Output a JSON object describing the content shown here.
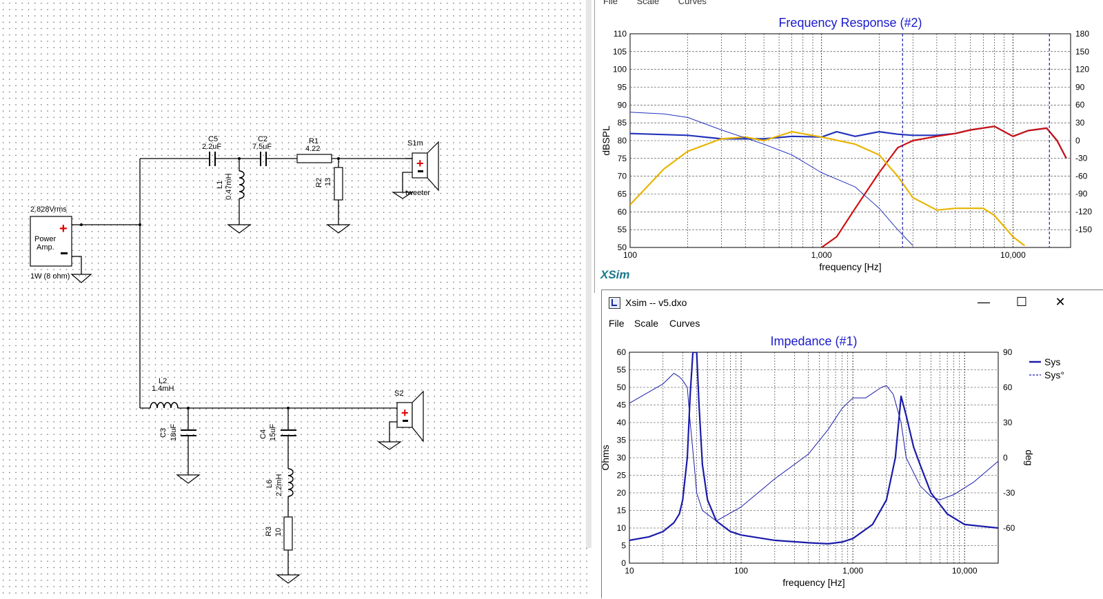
{
  "schematic": {
    "source_label": "2.828Vrms",
    "amp_label_line1": "Power",
    "amp_label_line2": "Amp.",
    "amp_power_label": "1W (8 ohm)",
    "components": {
      "C5": {
        "name": "C5",
        "value": "2.2uF"
      },
      "C2": {
        "name": "C2",
        "value": "7.5uF"
      },
      "R1": {
        "name": "R1",
        "value": "4.22"
      },
      "L1": {
        "name": "L1",
        "value": "0.47mH"
      },
      "R2": {
        "name": "R2",
        "value": "13"
      },
      "S1m": {
        "name": "S1m",
        "label": "tweeter"
      },
      "L2": {
        "name": "L2",
        "value": "1.4mH"
      },
      "C3": {
        "name": "C3",
        "value": "18uF"
      },
      "C4": {
        "name": "C4",
        "value": "15uF"
      },
      "L6": {
        "name": "L6",
        "value": "2.2mH"
      },
      "R3": {
        "name": "R3",
        "value": "10"
      },
      "S2": {
        "name": "S2"
      }
    }
  },
  "fr_window": {
    "menu": [
      "File",
      "Scale",
      "Curves"
    ],
    "logo": "XSim"
  },
  "imp_window": {
    "title": "Xsim -- v5.dxo",
    "menu": [
      "File",
      "Scale",
      "Curves"
    ],
    "controls": {
      "minimize": "—",
      "maximize": "☐",
      "close": "✕"
    }
  },
  "chart_data": [
    {
      "type": "line",
      "title": "Frequency Response (#2)",
      "xlabel": "frequency [Hz]",
      "ylabel": "dBSPL",
      "x_scale": "log",
      "xlim": [
        100,
        20000
      ],
      "ylim": [
        50,
        110
      ],
      "x_ticks": [
        "100",
        "1,000",
        "10,000"
      ],
      "y_ticks": [
        110,
        105,
        100,
        95,
        90,
        85,
        80,
        75,
        70,
        65,
        60,
        55,
        50
      ],
      "right_ticks": [
        "180",
        "150",
        "120",
        "90",
        "60",
        "30",
        "0",
        "-30",
        "-60",
        "-90",
        "-120",
        "-150"
      ],
      "grid": true,
      "series": [
        {
          "color": "#2233bb",
          "values": [
            [
              100,
              82
            ],
            [
              200,
              81.5
            ],
            [
              300,
              80.5
            ],
            [
              500,
              80.5
            ],
            [
              700,
              81.2
            ],
            [
              1000,
              81
            ],
            [
              1200,
              82.5
            ],
            [
              1500,
              81.2
            ],
            [
              2000,
              82.5
            ],
            [
              2500,
              81.8
            ],
            [
              3000,
              81.5
            ],
            [
              4000,
              81.5
            ],
            [
              5000,
              82
            ],
            [
              6000,
              83
            ],
            [
              8000,
              84
            ],
            [
              10000,
              81.2
            ],
            [
              12000,
              82.8
            ],
            [
              15000,
              83.5
            ],
            [
              17000,
              80
            ],
            [
              19000,
              75
            ]
          ]
        },
        {
          "color": "#cc1111",
          "values": [
            [
              1000,
              50
            ],
            [
              1200,
              53
            ],
            [
              1500,
              61
            ],
            [
              2000,
              71
            ],
            [
              2500,
              78
            ],
            [
              3000,
              80
            ],
            [
              4000,
              81.2
            ],
            [
              5000,
              82
            ],
            [
              6000,
              83
            ],
            [
              8000,
              84
            ],
            [
              10000,
              81.2
            ],
            [
              12000,
              82.8
            ],
            [
              15000,
              83.5
            ],
            [
              17000,
              80
            ],
            [
              19000,
              75
            ]
          ]
        },
        {
          "color": "#e8b400",
          "values": [
            [
              100,
              62
            ],
            [
              150,
              72
            ],
            [
              200,
              77
            ],
            [
              300,
              80.5
            ],
            [
              400,
              81
            ],
            [
              500,
              80
            ],
            [
              700,
              82.5
            ],
            [
              1000,
              81
            ],
            [
              1500,
              79
            ],
            [
              2000,
              76
            ],
            [
              2500,
              70
            ],
            [
              3000,
              64
            ],
            [
              4000,
              60.5
            ],
            [
              5000,
              61
            ],
            [
              7000,
              61
            ],
            [
              8000,
              59
            ],
            [
              10000,
              53
            ],
            [
              11500,
              50.5
            ]
          ]
        },
        {
          "color": "#2233bb",
          "thin": true,
          "values": [
            [
              100,
              88
            ],
            [
              150,
              87.5
            ],
            [
              200,
              86.5
            ],
            [
              300,
              83
            ],
            [
              500,
              79
            ],
            [
              700,
              76
            ],
            [
              1000,
              71
            ],
            [
              1500,
              67
            ],
            [
              2000,
              61
            ],
            [
              2500,
              55
            ],
            [
              3000,
              50.5
            ]
          ]
        }
      ]
    },
    {
      "type": "line",
      "title": "Impedance (#1)",
      "xlabel": "frequency [Hz]",
      "ylabel": "Ohms",
      "ylabel_right": "deg",
      "x_scale": "log",
      "xlim": [
        10,
        20000
      ],
      "ylim": [
        0,
        60
      ],
      "x_ticks": [
        "10",
        "100",
        "1,000",
        "10,000"
      ],
      "y_ticks": [
        60,
        55,
        50,
        45,
        40,
        35,
        30,
        25,
        20,
        15,
        10,
        5,
        0
      ],
      "right_ticks": [
        "90",
        "60",
        "30",
        "0",
        "-30",
        "-60"
      ],
      "legend": {
        "position": "top-right",
        "entries": [
          "Sys",
          "Sys°"
        ]
      },
      "series": [
        {
          "name": "Sys",
          "color": "#1a1aaa",
          "values": [
            [
              10,
              6.5
            ],
            [
              15,
              7.5
            ],
            [
              20,
              9
            ],
            [
              25,
              11.5
            ],
            [
              28,
              14
            ],
            [
              30,
              18
            ],
            [
              33,
              30
            ],
            [
              35,
              48
            ],
            [
              37,
              60
            ],
            [
              40,
              60
            ],
            [
              42,
              45
            ],
            [
              45,
              28
            ],
            [
              50,
              18
            ],
            [
              60,
              12
            ],
            [
              80,
              9
            ],
            [
              100,
              8
            ],
            [
              200,
              6.5
            ],
            [
              400,
              5.8
            ],
            [
              600,
              5.5
            ],
            [
              800,
              6
            ],
            [
              1000,
              7
            ],
            [
              1500,
              11
            ],
            [
              2000,
              18
            ],
            [
              2400,
              30
            ],
            [
              2700,
              47.5
            ],
            [
              3000,
              42
            ],
            [
              3500,
              33
            ],
            [
              4000,
              28
            ],
            [
              5000,
              20
            ],
            [
              7000,
              14
            ],
            [
              10000,
              11
            ],
            [
              20000,
              10
            ]
          ]
        },
        {
          "name": "Sys°",
          "color": "#1a1aaa",
          "thin": true,
          "values": [
            [
              10,
              45.5
            ],
            [
              20,
              51
            ],
            [
              25,
              54
            ],
            [
              28,
              53
            ],
            [
              30,
              52
            ],
            [
              33,
              50
            ],
            [
              35,
              40
            ],
            [
              38,
              28
            ],
            [
              40,
              20
            ],
            [
              45,
              15
            ],
            [
              60,
              12
            ],
            [
              100,
              16
            ],
            [
              200,
              24
            ],
            [
              400,
              31
            ],
            [
              600,
              38
            ],
            [
              800,
              44
            ],
            [
              1000,
              47
            ],
            [
              1300,
              47
            ],
            [
              1800,
              50
            ],
            [
              2000,
              50.5
            ],
            [
              2300,
              48
            ],
            [
              2700,
              40
            ],
            [
              3000,
              30
            ],
            [
              4000,
              22
            ],
            [
              5000,
              19
            ],
            [
              6000,
              18
            ],
            [
              8000,
              19.5
            ],
            [
              12000,
              23
            ],
            [
              20000,
              29
            ]
          ]
        }
      ]
    }
  ]
}
